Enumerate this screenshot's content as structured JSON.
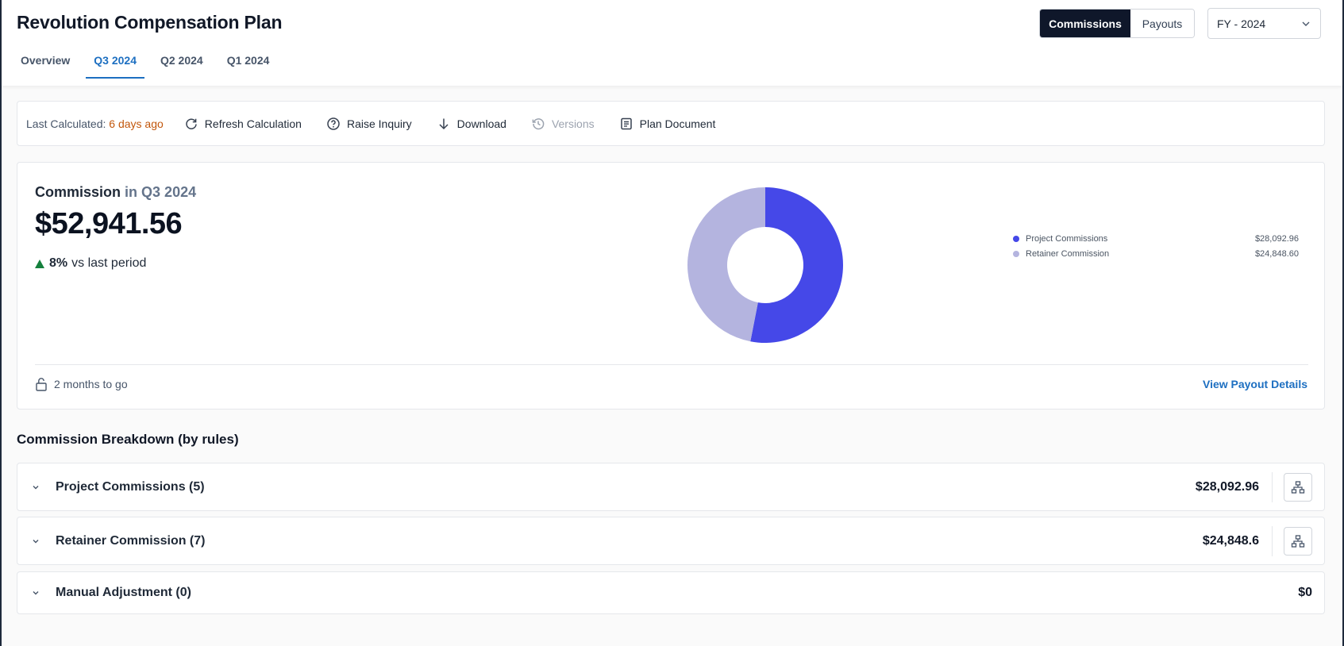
{
  "header": {
    "title": "Revolution Compensation Plan",
    "view_toggle": {
      "commissions": "Commissions",
      "payouts": "Payouts"
    },
    "fiscal_year": "FY - 2024"
  },
  "tabs": [
    {
      "label": "Overview"
    },
    {
      "label": "Q3 2024"
    },
    {
      "label": "Q2 2024"
    },
    {
      "label": "Q1 2024"
    }
  ],
  "toolbar": {
    "last_calculated_label": "Last Calculated:",
    "last_calculated_value": "6 days ago",
    "refresh": "Refresh Calculation",
    "raise_inquiry": "Raise Inquiry",
    "download": "Download",
    "versions": "Versions",
    "plan_document": "Plan Document"
  },
  "summary": {
    "heading": "Commission",
    "period": "in Q3 2024",
    "total": "$52,941.56",
    "trend_pct": "8%",
    "trend_text": "vs last period",
    "time_left": "2 months to go",
    "view_payout": "View Payout Details"
  },
  "chart_data": {
    "type": "pie",
    "categories": [
      "Project Commissions",
      "Retainer Commission"
    ],
    "values": [
      28092.96,
      24848.6
    ],
    "value_labels": [
      "$28,092.96",
      "$24,848.60"
    ],
    "colors": [
      "#4548e8",
      "#b4b4df"
    ],
    "legend": "right"
  },
  "breakdown": {
    "title": "Commission Breakdown (by rules)",
    "rows": [
      {
        "name": "Project Commissions (5)",
        "amount": "$28,092.96"
      },
      {
        "name": "Retainer Commission (7)",
        "amount": "$24,848.6"
      },
      {
        "name": "Manual Adjustment (0)",
        "amount": "$0"
      }
    ]
  },
  "colors": {
    "accent": "#1d6fc1",
    "dark": "#0f172a",
    "warning": "#c2570c",
    "positive": "#15803d"
  }
}
